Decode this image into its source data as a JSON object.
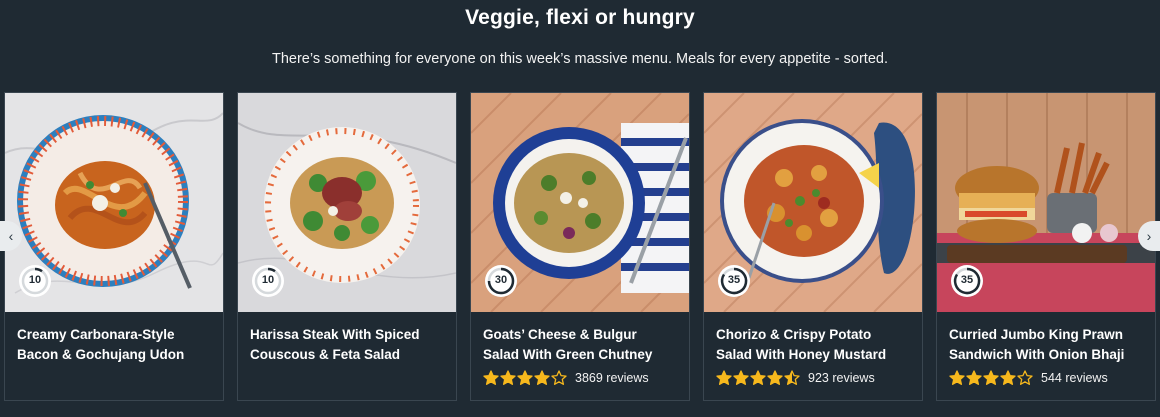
{
  "header": {
    "title": "Veggie, flexi or hungry",
    "subtitle": "There’s something for everyone on this week’s massive menu. Meals for every appetite - sorted."
  },
  "colors": {
    "background": "#1f2a33",
    "star": "#f6b81d",
    "text": "#ffffff"
  },
  "icons": {
    "prev": "chevron-left-icon",
    "next": "chevron-right-icon",
    "timer": "clock-timer-icon",
    "star": "star-icon"
  },
  "recipes": [
    {
      "name_line1": "Creamy Carbonara-Style",
      "name_line2": "Bacon & Gochujang Udon",
      "time": "10",
      "rating": null,
      "reviews": ""
    },
    {
      "name_line1": "Harissa Steak With Spiced",
      "name_line2": "Couscous & Feta Salad",
      "time": "10",
      "rating": null,
      "reviews": ""
    },
    {
      "name_line1": "Goats’ Cheese & Bulgur",
      "name_line2": "Salad With Green Chutney",
      "time": "30",
      "rating": 4,
      "reviews": "3869 reviews"
    },
    {
      "name_line1": "Chorizo & Crispy Potato",
      "name_line2": "Salad With Honey Mustard",
      "time": "35",
      "rating": 4.5,
      "reviews": "923 reviews"
    },
    {
      "name_line1": "Curried Jumbo King Prawn",
      "name_line2": "Sandwich With Onion Bhaji",
      "time": "35",
      "rating": 4,
      "reviews": "544 reviews"
    }
  ]
}
